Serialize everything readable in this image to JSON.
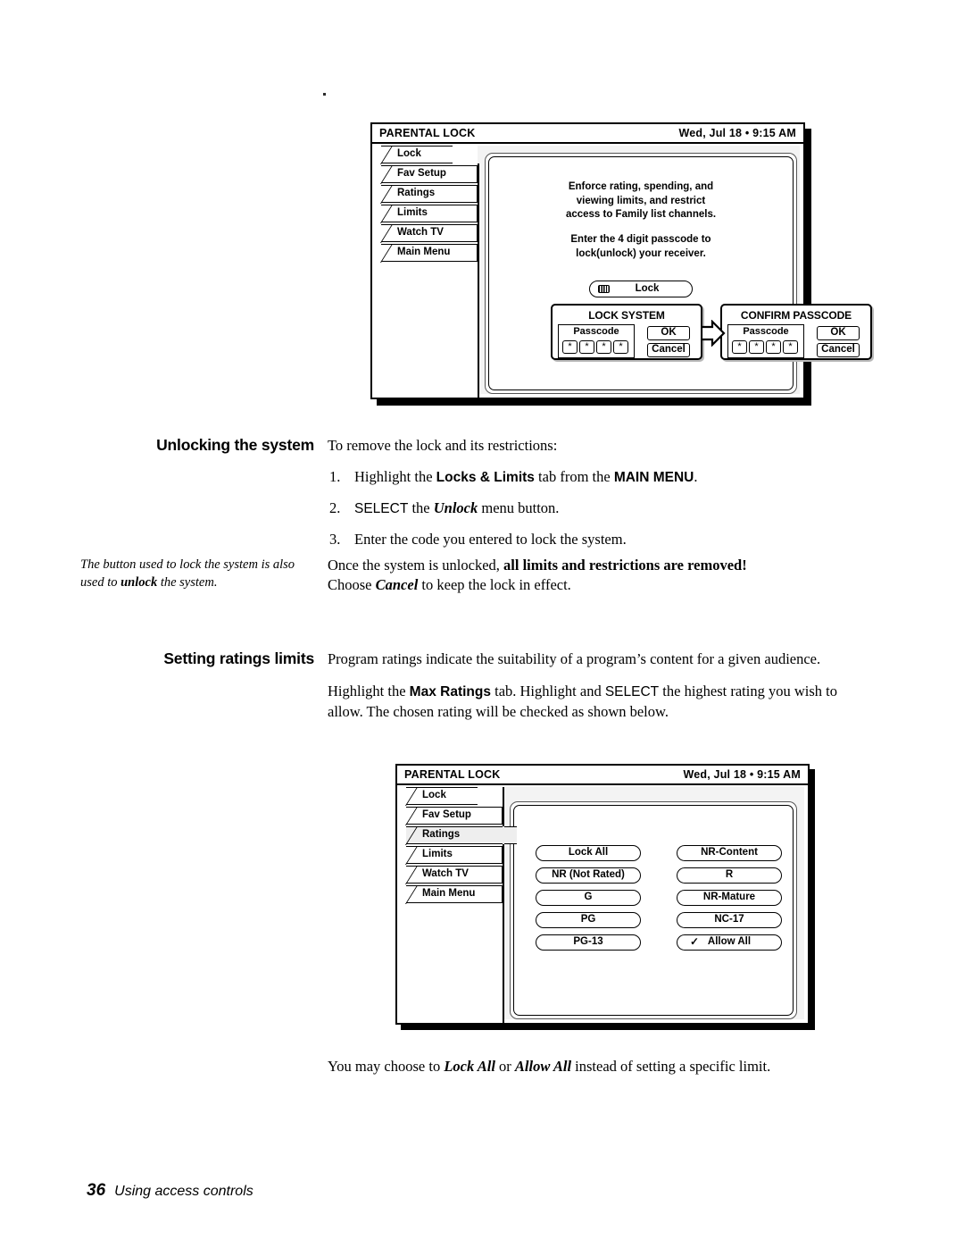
{
  "page": {
    "number": "36",
    "footer_text": "Using access controls"
  },
  "figure1": {
    "title": "PARENTAL LOCK",
    "datetime": "Wed, Jul 18 • 9:15 AM",
    "tabs": [
      {
        "label": "Lock",
        "state": "first"
      },
      {
        "label": "Fav Setup",
        "state": "normal"
      },
      {
        "label": "Ratings",
        "state": "normal"
      },
      {
        "label": "Limits",
        "state": "normal"
      },
      {
        "label": "Watch TV",
        "state": "normal"
      },
      {
        "label": "Main Menu",
        "state": "normal"
      }
    ],
    "paragraph1": "Enforce rating, spending, and viewing limits, and restrict access to Family list channels.",
    "paragraph1_lines": [
      "Enforce rating, spending, and",
      "viewing limits, and restrict",
      "access to Family list channels."
    ],
    "paragraph2_lines": [
      "Enter the 4 digit passcode to",
      "lock(unlock) your receiver."
    ],
    "lock_button": {
      "label": "Lock",
      "icon": "remote-keypad-icon"
    },
    "dialog_lock": {
      "title": "LOCK SYSTEM",
      "passcode_label": "Passcode",
      "digits": [
        "*",
        "*",
        "*",
        "*"
      ],
      "ok_label": "OK",
      "cancel_label": "Cancel"
    },
    "dialog_confirm": {
      "title": "CONFIRM PASSCODE",
      "passcode_label": "Passcode",
      "digits": [
        "*",
        "*",
        "*",
        "*"
      ],
      "ok_label": "OK",
      "cancel_label": "Cancel"
    }
  },
  "figure2": {
    "title": "PARENTAL LOCK",
    "datetime": "Wed, Jul 18 • 9:15 AM",
    "tabs": [
      {
        "label": "Lock",
        "state": "first"
      },
      {
        "label": "Fav Setup",
        "state": "normal"
      },
      {
        "label": "Ratings",
        "state": "selected"
      },
      {
        "label": "Limits",
        "state": "normal"
      },
      {
        "label": "Watch TV",
        "state": "normal"
      },
      {
        "label": "Main Menu",
        "state": "normal"
      }
    ],
    "rating_rows": [
      {
        "left": "Lock All",
        "right": "NR-Content",
        "right_checked": false
      },
      {
        "left": "NR (Not Rated)",
        "right": "R",
        "right_checked": false
      },
      {
        "left": "G",
        "right": "NR-Mature",
        "right_checked": false
      },
      {
        "left": "PG",
        "right": "NC-17",
        "right_checked": false
      },
      {
        "left": "PG-13",
        "right": "Allow All",
        "right_checked": true
      }
    ]
  },
  "section_unlock": {
    "heading": "Unlocking the system",
    "intro": "To remove the lock and its restrictions:",
    "steps": [
      {
        "num": "1.",
        "pre": "Highlight the ",
        "bold1": "Locks & Limits",
        "mid": " tab from the ",
        "bold2": "MAIN MENU",
        "post": "."
      },
      {
        "num": "2.",
        "pre": "SELECT",
        "mid_plain": " the ",
        "italic": "Unlock",
        "post": " menu button."
      },
      {
        "num": "3.",
        "text": "Enter the code you entered to lock the system."
      }
    ],
    "margin_note": {
      "line1": "The button used to lock the system",
      "line2_pre": "is also used to ",
      "line2_bold": "unlock",
      "line2_post": " the system."
    },
    "closing_pre": "Once the system is unlocked, ",
    "closing_bold": "all limits and restrictions are removed!",
    "closing2_pre": "Choose ",
    "closing2_italic": "Cancel",
    "closing2_post": " to keep the lock in effect."
  },
  "section_ratings": {
    "heading": "Setting ratings limits",
    "para1": "Program ratings indicate the suitability of a program’s content for a given audience.",
    "para2_pre": "Highlight the ",
    "para2_bold": "Max Ratings",
    "para2_mid": " tab. Highlight and ",
    "para2_sc": "SELECT",
    "para2_post": " the highest rating you wish to allow. The chosen rating will be checked as shown below.",
    "closing_pre": "You may choose to ",
    "closing_i1": "Lock All",
    "closing_mid": " or ",
    "closing_i2": "Allow All",
    "closing_post": " instead of setting a specific limit."
  },
  "colors": {
    "ink": "#000000",
    "panel_tint": "#f3f3f3",
    "selected_tab": "#eeeeee"
  }
}
